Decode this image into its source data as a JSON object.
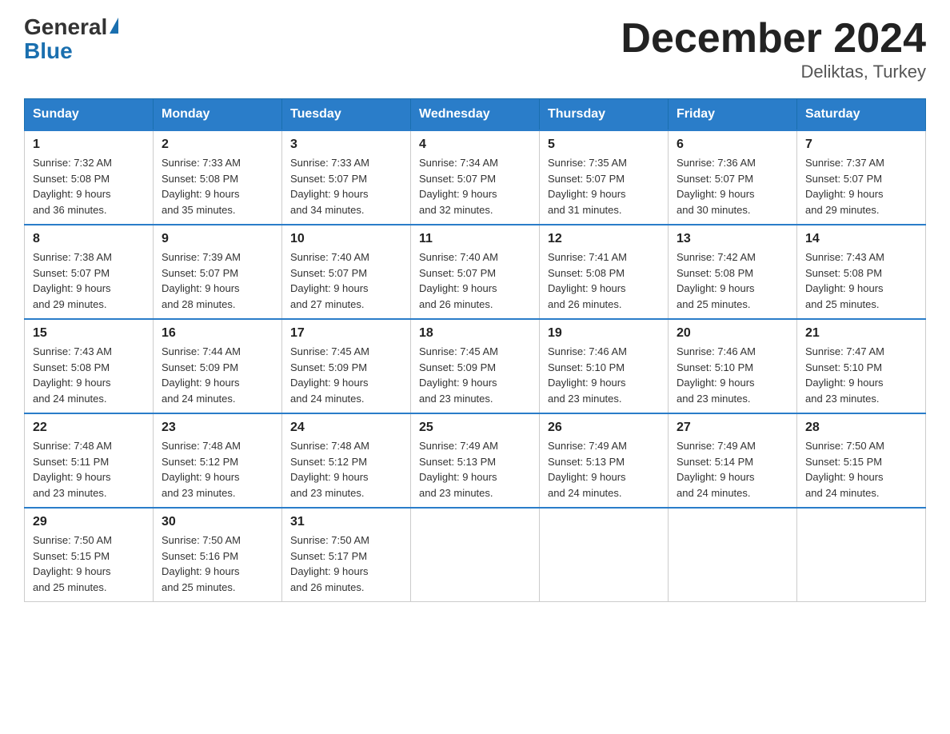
{
  "header": {
    "logo_general": "General",
    "logo_blue": "Blue",
    "month_title": "December 2024",
    "location": "Deliktas, Turkey"
  },
  "days_of_week": [
    "Sunday",
    "Monday",
    "Tuesday",
    "Wednesday",
    "Thursday",
    "Friday",
    "Saturday"
  ],
  "weeks": [
    [
      {
        "day": "1",
        "sunrise": "7:32 AM",
        "sunset": "5:08 PM",
        "daylight": "9 hours and 36 minutes."
      },
      {
        "day": "2",
        "sunrise": "7:33 AM",
        "sunset": "5:08 PM",
        "daylight": "9 hours and 35 minutes."
      },
      {
        "day": "3",
        "sunrise": "7:33 AM",
        "sunset": "5:07 PM",
        "daylight": "9 hours and 34 minutes."
      },
      {
        "day": "4",
        "sunrise": "7:34 AM",
        "sunset": "5:07 PM",
        "daylight": "9 hours and 32 minutes."
      },
      {
        "day": "5",
        "sunrise": "7:35 AM",
        "sunset": "5:07 PM",
        "daylight": "9 hours and 31 minutes."
      },
      {
        "day": "6",
        "sunrise": "7:36 AM",
        "sunset": "5:07 PM",
        "daylight": "9 hours and 30 minutes."
      },
      {
        "day": "7",
        "sunrise": "7:37 AM",
        "sunset": "5:07 PM",
        "daylight": "9 hours and 29 minutes."
      }
    ],
    [
      {
        "day": "8",
        "sunrise": "7:38 AM",
        "sunset": "5:07 PM",
        "daylight": "9 hours and 29 minutes."
      },
      {
        "day": "9",
        "sunrise": "7:39 AM",
        "sunset": "5:07 PM",
        "daylight": "9 hours and 28 minutes."
      },
      {
        "day": "10",
        "sunrise": "7:40 AM",
        "sunset": "5:07 PM",
        "daylight": "9 hours and 27 minutes."
      },
      {
        "day": "11",
        "sunrise": "7:40 AM",
        "sunset": "5:07 PM",
        "daylight": "9 hours and 26 minutes."
      },
      {
        "day": "12",
        "sunrise": "7:41 AM",
        "sunset": "5:08 PM",
        "daylight": "9 hours and 26 minutes."
      },
      {
        "day": "13",
        "sunrise": "7:42 AM",
        "sunset": "5:08 PM",
        "daylight": "9 hours and 25 minutes."
      },
      {
        "day": "14",
        "sunrise": "7:43 AM",
        "sunset": "5:08 PM",
        "daylight": "9 hours and 25 minutes."
      }
    ],
    [
      {
        "day": "15",
        "sunrise": "7:43 AM",
        "sunset": "5:08 PM",
        "daylight": "9 hours and 24 minutes."
      },
      {
        "day": "16",
        "sunrise": "7:44 AM",
        "sunset": "5:09 PM",
        "daylight": "9 hours and 24 minutes."
      },
      {
        "day": "17",
        "sunrise": "7:45 AM",
        "sunset": "5:09 PM",
        "daylight": "9 hours and 24 minutes."
      },
      {
        "day": "18",
        "sunrise": "7:45 AM",
        "sunset": "5:09 PM",
        "daylight": "9 hours and 23 minutes."
      },
      {
        "day": "19",
        "sunrise": "7:46 AM",
        "sunset": "5:10 PM",
        "daylight": "9 hours and 23 minutes."
      },
      {
        "day": "20",
        "sunrise": "7:46 AM",
        "sunset": "5:10 PM",
        "daylight": "9 hours and 23 minutes."
      },
      {
        "day": "21",
        "sunrise": "7:47 AM",
        "sunset": "5:10 PM",
        "daylight": "9 hours and 23 minutes."
      }
    ],
    [
      {
        "day": "22",
        "sunrise": "7:48 AM",
        "sunset": "5:11 PM",
        "daylight": "9 hours and 23 minutes."
      },
      {
        "day": "23",
        "sunrise": "7:48 AM",
        "sunset": "5:12 PM",
        "daylight": "9 hours and 23 minutes."
      },
      {
        "day": "24",
        "sunrise": "7:48 AM",
        "sunset": "5:12 PM",
        "daylight": "9 hours and 23 minutes."
      },
      {
        "day": "25",
        "sunrise": "7:49 AM",
        "sunset": "5:13 PM",
        "daylight": "9 hours and 23 minutes."
      },
      {
        "day": "26",
        "sunrise": "7:49 AM",
        "sunset": "5:13 PM",
        "daylight": "9 hours and 24 minutes."
      },
      {
        "day": "27",
        "sunrise": "7:49 AM",
        "sunset": "5:14 PM",
        "daylight": "9 hours and 24 minutes."
      },
      {
        "day": "28",
        "sunrise": "7:50 AM",
        "sunset": "5:15 PM",
        "daylight": "9 hours and 24 minutes."
      }
    ],
    [
      {
        "day": "29",
        "sunrise": "7:50 AM",
        "sunset": "5:15 PM",
        "daylight": "9 hours and 25 minutes."
      },
      {
        "day": "30",
        "sunrise": "7:50 AM",
        "sunset": "5:16 PM",
        "daylight": "9 hours and 25 minutes."
      },
      {
        "day": "31",
        "sunrise": "7:50 AM",
        "sunset": "5:17 PM",
        "daylight": "9 hours and 26 minutes."
      },
      null,
      null,
      null,
      null
    ]
  ],
  "labels": {
    "sunrise": "Sunrise:",
    "sunset": "Sunset:",
    "daylight": "Daylight:"
  }
}
